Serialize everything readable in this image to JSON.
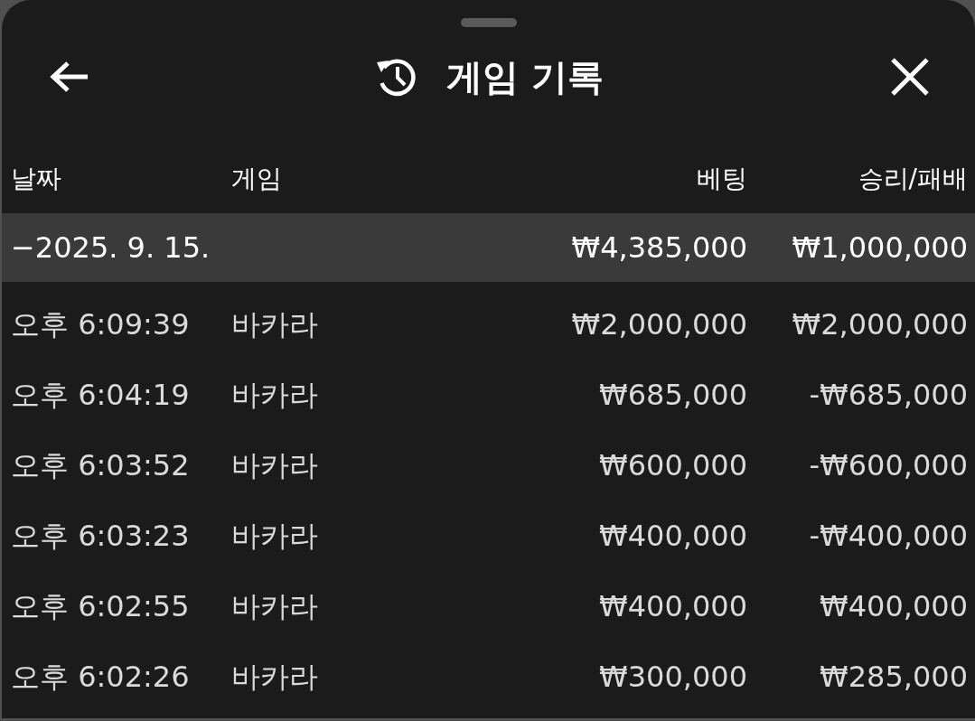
{
  "header": {
    "title": "게임 기록"
  },
  "table": {
    "columns": [
      "날짜",
      "게임",
      "베팅",
      "승리/패배"
    ],
    "groups": [
      {
        "toggle": "−",
        "date": "2025. 9. 15.",
        "bet": "₩4,385,000",
        "result": "₩1,000,000",
        "rows": [
          {
            "time": "오후 6:09:39",
            "game": "바카라",
            "bet": "₩2,000,000",
            "result": "₩2,000,000"
          },
          {
            "time": "오후 6:04:19",
            "game": "바카라",
            "bet": "₩685,000",
            "result": "-₩685,000"
          },
          {
            "time": "오후 6:03:52",
            "game": "바카라",
            "bet": "₩600,000",
            "result": "-₩600,000"
          },
          {
            "time": "오후 6:03:23",
            "game": "바카라",
            "bet": "₩400,000",
            "result": "-₩400,000"
          },
          {
            "time": "오후 6:02:55",
            "game": "바카라",
            "bet": "₩400,000",
            "result": "₩400,000"
          },
          {
            "time": "오후 6:02:26",
            "game": "바카라",
            "bet": "₩300,000",
            "result": "₩285,000"
          }
        ]
      }
    ]
  }
}
